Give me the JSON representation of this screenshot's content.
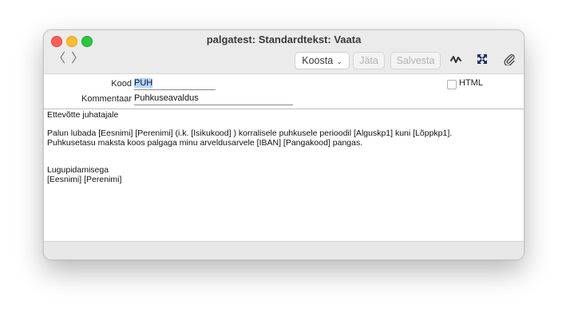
{
  "window": {
    "title": "palgatest: Standardtekst: Vaata"
  },
  "toolbar": {
    "back_glyph": "〈",
    "forward_glyph": "〉",
    "koosta_label": "Koosta",
    "koosta_chevron": "⌄",
    "jata_label": "Jäta",
    "salvesta_label": "Salvesta",
    "icons": [
      "activity-icon",
      "expand-icon",
      "paperclip-icon"
    ]
  },
  "form": {
    "kood_label": "Kood",
    "kood_value": "PUH",
    "kommentaar_label": "Kommentaar",
    "kommentaar_value": "Puhkuseavaldus",
    "html_label": "HTML"
  },
  "editor": {
    "lines": [
      "Ettevõtte juhatajale",
      "",
      "Palun lubada [Eesnimi] [Perenimi]  (i.k. [Isikukood] ) korralisele puhkusele perioodil [Alguskp1] kuni [Lõppkp1].",
      "Puhkusetasu maksta koos palgaga minu arveldusarvele [IBAN] [Pangakood] pangas.",
      "",
      "",
      "Lugupidamisega",
      "[Eesnimi] [Perenimi]"
    ]
  },
  "colors": {
    "close": "#fe5f57",
    "minimize": "#febc2e",
    "maximize": "#28c840",
    "selection": "#b3d7ff"
  }
}
